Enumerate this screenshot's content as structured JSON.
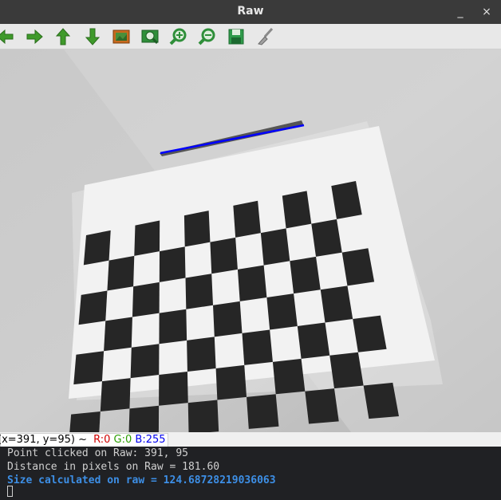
{
  "window": {
    "title": "Raw",
    "minimize_glyph": "_",
    "close_glyph": "×"
  },
  "toolbar": {
    "buttons": [
      {
        "name": "pan-left-icon"
      },
      {
        "name": "pan-right-icon"
      },
      {
        "name": "pan-up-icon"
      },
      {
        "name": "pan-down-icon"
      },
      {
        "name": "zoom-fit-icon"
      },
      {
        "name": "zoom-original-icon"
      },
      {
        "name": "zoom-in-icon"
      },
      {
        "name": "zoom-out-icon"
      },
      {
        "name": "save-icon"
      },
      {
        "name": "properties-brush-icon"
      }
    ],
    "colors": {
      "arrow": "#3f9a2b",
      "zoom": "#2f8f3a",
      "save": "#2f9a4a"
    }
  },
  "statusbar": {
    "coords": "(x=391, y=95) ~",
    "r": "R:0",
    "g": "G:0",
    "b": "B:255",
    "colors": {
      "r": "#d00000",
      "g": "#2a9d00",
      "b": "#0000ee"
    }
  },
  "terminal": {
    "line1": "Point clicked on Raw: 391, 95",
    "line2": "Distance in pixels on Raw = 181.60",
    "line3": "Size calculated on raw = 124.68728219036063",
    "highlight_color": "#3d8fe6"
  },
  "image": {
    "line_color": "#0000ff"
  }
}
